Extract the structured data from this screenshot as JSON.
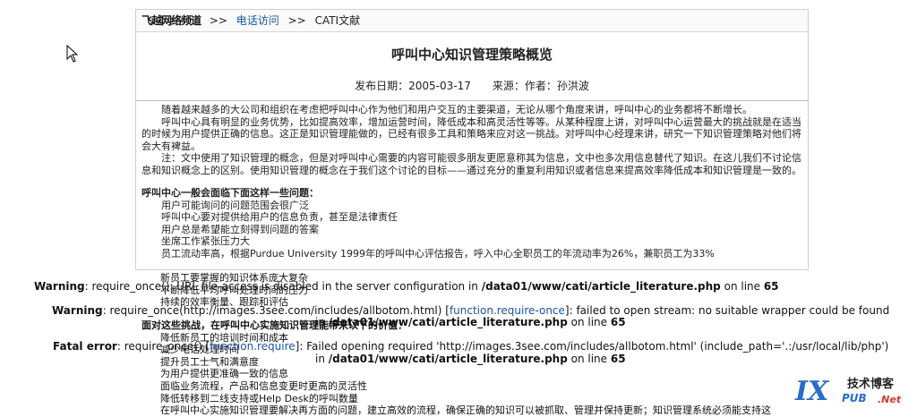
{
  "breadcrumb": {
    "site": "飞越网络频道",
    "sep1": ">>",
    "section": "电话访问",
    "sep2": ">>",
    "current": "CATI文献"
  },
  "article": {
    "title": "呼叫中心知识管理策略概览",
    "meta": "发布日期：2005-03-17　　来源：作者：孙洪波",
    "paragraphs": [
      "随着越来越多的大公司和组织在考虑把呼叫中心作为他们和用户交互的主要渠道，无论从哪个角度来讲，呼叫中心的业务都将不断增长。",
      "呼叫中心具有明显的业务优势，比如提高效率，增加运营时间，降低成本和高灵活性等等。从某种程度上讲，对呼叫中心运营最大的挑战就是在适当的时候为用户提供正确的信息。这正是知识管理能做的，已经有很多工具和策略来应对这一挑战。对呼叫中心经理来讲，研究一下知识管理策略对他们将会大有裨益。",
      "注：文中使用了知识管理的概念，但是对呼叫中心需要的内容可能很多朋友更愿意称其为信息，文中也多次用信息替代了知识。在这儿我们不讨论信息和知识概念上的区别。使用知识管理的概念在于我们这个讨论的目标——通过充分的重复利用知识或者信息来提高效率降低成本和知识管理是一致的。"
    ],
    "section_head": "呼叫中心一般会面临下面这样一些问题：",
    "issues": [
      "用户可能询问的问题范围会很广泛",
      "呼叫中心要对提供给用户的信息负责，甚至是法律责任",
      "用户总是希望能立刻得到问题的答案",
      "坐席工作紧张压力大",
      "员工流动率高，根据Purdue University 1999年的呼叫中心评估报告，呼入中心全职员工的年流动率为26%，兼职员工为33%"
    ]
  },
  "lower_lines": [
    "新员工要掌握的知识体系庞大复杂",
    "不断降低平均呼叫处理时间的压力",
    "持续的效率衡量、跟踪和评估",
    "减少电话处理时间",
    "降低新员工的培训时间和成本",
    "提升员工士气和满意度",
    "为用户提供更准确一致的信息",
    "面临业务流程，产品和信息变更时更高的灵活性",
    "降低转移到二线支持或Help Desk的呼叫数量",
    "在呼叫中心实施知识管理要解决再方面的问题，建立高效的流程，确保正确的知识可以被抓取、管理并保持更新；知识管理系统必须能支持这"
  ],
  "lower_head": "面对这些挑战，在呼叫中心实施知识管理能带来以下的价值：",
  "errors": {
    "w1_label": "Warning",
    "w1_text": ": require_once(): URL file-access is disabled in the server configuration in ",
    "w1_path": "/data01/www/cati/article_literature.php",
    "w1_line_word": " on line ",
    "w1_line": "65",
    "w2_label": "Warning",
    "w2_text_a": ": require_once(http://images.3see.com/includes/allbotom.html) [",
    "w2_link": "function.require-once",
    "w2_text_b": "]: failed to open stream: no suitable wrapper could be found",
    "w2_cont_in": "in ",
    "w2_path": "/data01/www/cati/article_literature.php",
    "w2_line_word": " on line ",
    "w2_line": "65",
    "f_label": "Fatal error",
    "f_text_a": ": require_once() [",
    "f_link": "function.require",
    "f_text_b": "]: Failed opening required 'http://images.3see.com/includes/allbotom.html' (include_path='.:/usr/local/lib/php')",
    "f_cont_in": "in ",
    "f_path": "/data01/www/cati/article_literature.php",
    "f_line_word": " on line ",
    "f_line": "65"
  },
  "watermark": {
    "mark": "IX",
    "cn": "技术博客",
    "pub": "PUB",
    "net": ".Net"
  }
}
